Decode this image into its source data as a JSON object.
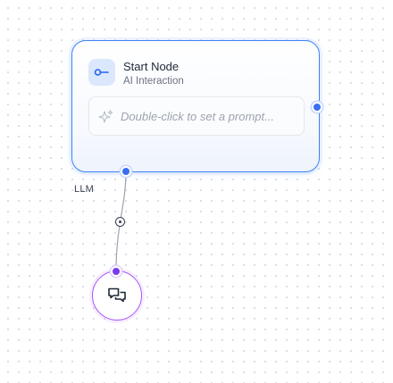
{
  "start_node": {
    "title": "Start Node",
    "subtitle": "AI Interaction",
    "prompt_placeholder": "Double-click to set a prompt...",
    "icon": "key-icon"
  },
  "edge": {
    "label": "LLM",
    "delete_icon": "target-icon"
  },
  "chat_node": {
    "icon": "chat-bubbles-icon"
  },
  "colors": {
    "start_node_border": "#3b82f6",
    "handle_blue": "#3b6ff0",
    "chat_node_border": "#a855f7",
    "handle_purple": "#7c3aed"
  }
}
